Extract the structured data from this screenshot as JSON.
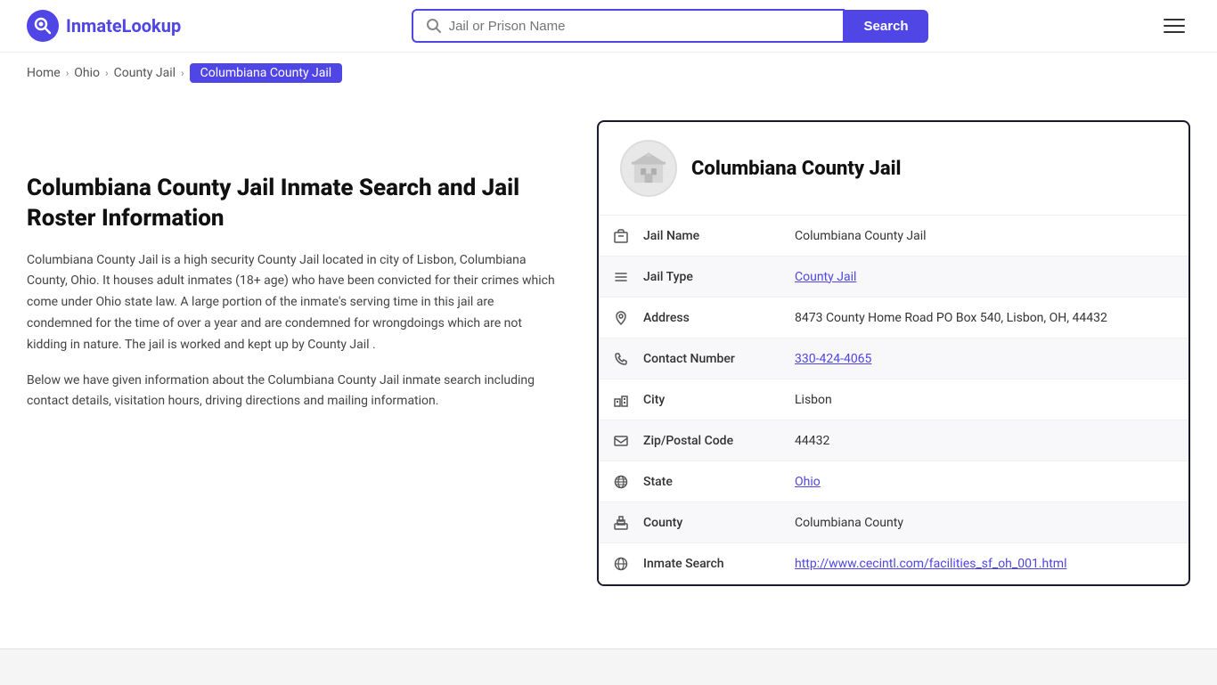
{
  "header": {
    "logo_letter": "Q",
    "logo_text_prefix": "Inmate",
    "logo_text_suffix": "Lookup",
    "search_placeholder": "Jail or Prison Name",
    "search_button_label": "Search"
  },
  "breadcrumb": {
    "items": [
      {
        "label": "Home",
        "href": "#"
      },
      {
        "label": "Ohio",
        "href": "#"
      },
      {
        "label": "County Jail",
        "href": "#"
      },
      {
        "label": "Columbiana County Jail",
        "active": true
      }
    ]
  },
  "page": {
    "title": "Columbiana County Jail Inmate Search and Jail Roster Information",
    "description1": "Columbiana County Jail is a high security County Jail located in city of Lisbon, Columbiana County, Ohio. It houses adult inmates (18+ age) who have been convicted for their crimes which come under Ohio state law. A large portion of the inmate's serving time in this jail are condemned for the time of over a year and are condemned for wrongdoings which are not kidding in nature. The jail is worked and kept up by County Jail .",
    "description2": "Below we have given information about the Columbiana County Jail inmate search including contact details, visitation hours, driving directions and mailing information."
  },
  "card": {
    "title": "Columbiana County Jail",
    "rows": [
      {
        "icon": "jail-icon",
        "label": "Jail Name",
        "value": "Columbiana County Jail",
        "link": false
      },
      {
        "icon": "list-icon",
        "label": "Jail Type",
        "value": "County Jail",
        "link": true,
        "href": "#"
      },
      {
        "icon": "location-icon",
        "label": "Address",
        "value": "8473 County Home Road PO Box 540, Lisbon, OH, 44432",
        "link": false
      },
      {
        "icon": "phone-icon",
        "label": "Contact Number",
        "value": "330-424-4065",
        "link": true,
        "href": "tel:330-424-4065"
      },
      {
        "icon": "city-icon",
        "label": "City",
        "value": "Lisbon",
        "link": false
      },
      {
        "icon": "mail-icon",
        "label": "Zip/Postal Code",
        "value": "44432",
        "link": false
      },
      {
        "icon": "globe-icon",
        "label": "State",
        "value": "Ohio",
        "link": true,
        "href": "#"
      },
      {
        "icon": "county-icon",
        "label": "County",
        "value": "Columbiana County",
        "link": false
      },
      {
        "icon": "search-globe-icon",
        "label": "Inmate Search",
        "value": "http://www.cecintl.com/facilities_sf_oh_001.html",
        "link": true,
        "href": "http://www.cecintl.com/facilities_sf_oh_001.html"
      }
    ]
  }
}
